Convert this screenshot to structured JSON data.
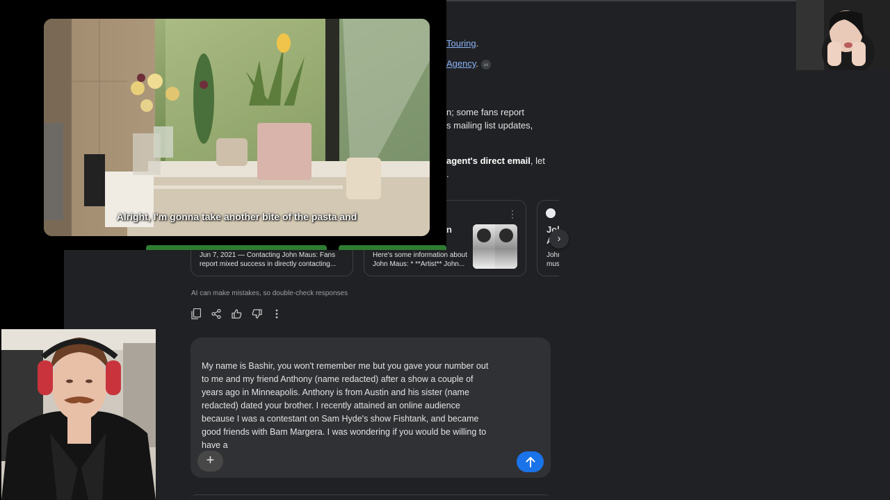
{
  "ai_answer": {
    "line1_link": "Touring",
    "line1_end": ".",
    "line2_link": "Agency",
    "line2_end": ".",
    "line3": "n; some fans report",
    "line4": "s mailing list updates,",
    "line5_bold": "agent's direct email",
    "line5_rest": ", let",
    "line6": "."
  },
  "source_cards": [
    {
      "snippet": "Jun 7, 2021 — Contacting John Maus: Fans report mixed success in directly contacting..."
    },
    {
      "heading": "n",
      "snippet": "Here's some information about John Maus: * **Artist** John..."
    },
    {
      "heading_line1": "Joh",
      "heading_line2": "A",
      "snippet_line1": "Johr",
      "snippet_line2": "mus"
    }
  ],
  "disclaimer": "AI can make mistakes, so double-check responses",
  "composer": {
    "text": "My name is Bashir, you won't remember me but you gave your number out\nto me and my friend Anthony (name redacted) after a show a couple of\nyears ago in Minneapolis. Anthony is from Austin and his sister (name\nredacted) dated your brother. I recently attained an online audience\nbecause I was a contestant on Sam Hyde's show Fishtank, and became\ngood friends with Bam Margera. I was wondering if you would be willing to\nhave a"
  },
  "video": {
    "subtitle": "Alright, I'm gonna take another bite of the pasta and"
  },
  "icons": {
    "copy": "copy-icon",
    "share": "share-icon",
    "thumbs_up": "thumbs-up-icon",
    "thumbs_down": "thumbs-down-icon",
    "more": "more-vert-icon",
    "add": "plus-icon",
    "send": "arrow-up-icon",
    "next": "chevron-right-icon",
    "link": "link-icon"
  },
  "colors": {
    "page_bg": "#202124",
    "link": "#8ab4f8",
    "composer_bg": "#303134",
    "send_button": "#1a73e8",
    "overlay_bg": "#000000"
  }
}
